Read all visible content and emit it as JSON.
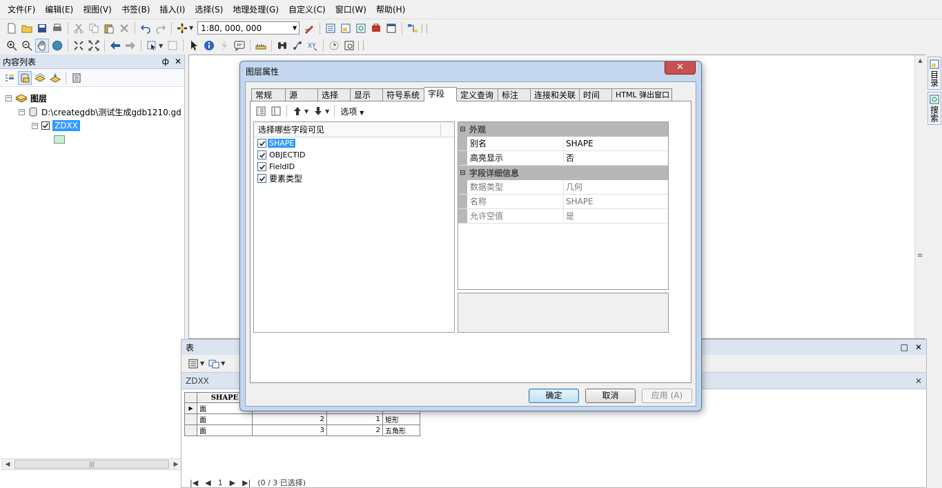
{
  "menu": [
    "文件(F)",
    "编辑(E)",
    "视图(V)",
    "书签(B)",
    "插入(I)",
    "选择(S)",
    "地理处理(G)",
    "自定义(C)",
    "窗口(W)",
    "帮助(H)"
  ],
  "toolbar": {
    "scale": "1:80, 000, 000"
  },
  "toc": {
    "title": "内容列表",
    "pin": "ф",
    "close": "✕",
    "tree": {
      "root_label": "图层",
      "db_label": "D:\\creategdb\\测试生成gdb1210.gd",
      "layer_label": "ZDXX"
    }
  },
  "right_dock": {
    "catalog_label": "目录",
    "search_label": "搜索"
  },
  "table_window": {
    "title": "表",
    "tab_label": "ZDXX",
    "columns": [
      "SHAPE",
      "",
      "",
      ""
    ],
    "rows": [
      {
        "marker": "▶",
        "shape": "面",
        "c2": "",
        "c3": "",
        "c4": ""
      },
      {
        "marker": "",
        "shape": "面",
        "c2": "2",
        "c3": "1",
        "c4": "矩形"
      },
      {
        "marker": "",
        "shape": "面",
        "c2": "3",
        "c3": "2",
        "c4": "五角形"
      }
    ],
    "footer": {
      "page": "1",
      "status": "(0 / 3 已选择)"
    }
  },
  "dialog": {
    "title": "图层属性",
    "close": "✕",
    "tabs": [
      "常规",
      "源",
      "选择",
      "显示",
      "符号系统",
      "字段",
      "定义查询",
      "标注",
      "连接和关联",
      "时间",
      "HTML 弹出窗口"
    ],
    "active_tab": "字段",
    "options_label": "选项",
    "field_list": {
      "header": "选择哪些字段可见",
      "fields": [
        "SHAPE",
        "OBJECTID",
        "FieldID",
        "要素类型"
      ]
    },
    "props": {
      "cat1": "外观",
      "alias_key": "别名",
      "alias_val": "SHAPE",
      "highlight_key": "高亮显示",
      "highlight_val": "否",
      "cat2": "字段详细信息",
      "dtype_key": "数据类型",
      "dtype_val": "几何",
      "name_key": "名称",
      "name_val": "SHAPE",
      "null_key": "允许空值",
      "null_val": "是"
    },
    "buttons": {
      "ok": "确定",
      "cancel": "取消",
      "apply": "应用 (A)"
    }
  }
}
